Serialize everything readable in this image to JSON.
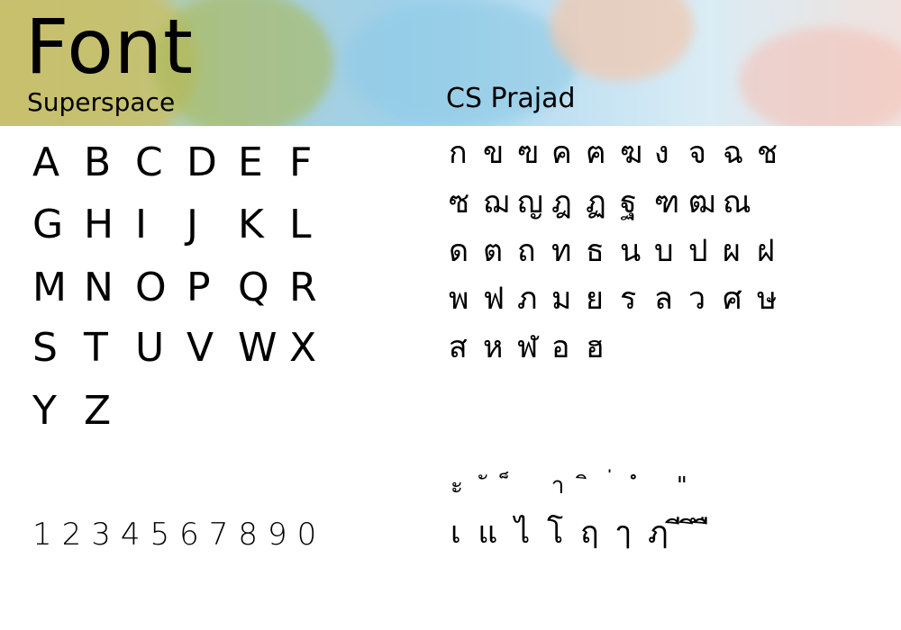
{
  "header": {
    "title": "Font",
    "subtitle": "Superspace",
    "thai_font_name": "CS Prajad"
  },
  "latin": {
    "rows": [
      [
        "A",
        "B",
        "C",
        "D",
        "E",
        "F"
      ],
      [
        "G",
        "H",
        "I",
        "J",
        "K",
        "L"
      ],
      [
        "M",
        "N",
        "O",
        "P",
        "Q",
        "R"
      ],
      [
        "S",
        "T",
        "U",
        "V",
        "W",
        "X"
      ],
      [
        "Y",
        "Z"
      ]
    ],
    "digits": "1234567890"
  },
  "thai": {
    "rows": [
      [
        "ก",
        "ข",
        "ฃ",
        "ค",
        "ฅ",
        "ฆ",
        "ง",
        "จ",
        "ฉ",
        "ช"
      ],
      [
        "ซ",
        "ฌ",
        "ญ",
        "ฎ",
        "ฏ",
        "ฐ",
        "ฑ",
        "ฒ",
        "ณ"
      ],
      [
        "ด",
        "ต",
        "ถ",
        "ท",
        "ธ",
        "น",
        "บ",
        "ป",
        "ผ",
        "ฝ"
      ],
      [
        "พ",
        "ฟ",
        "ภ",
        "ม",
        "ย",
        "ร",
        "ล",
        "ว",
        "ศ",
        "ษ"
      ],
      [
        "ส",
        "ห",
        "ฬ",
        "อ",
        "ฮ"
      ]
    ],
    "marks_line1": "ะ ั ็ า ิ ่ ํ \"",
    "marks_line2": "เ แ ไ โ ฤ ๅ ฦ ี ึ ื"
  },
  "colors": {
    "text": "#000000",
    "background": "#ffffff"
  }
}
